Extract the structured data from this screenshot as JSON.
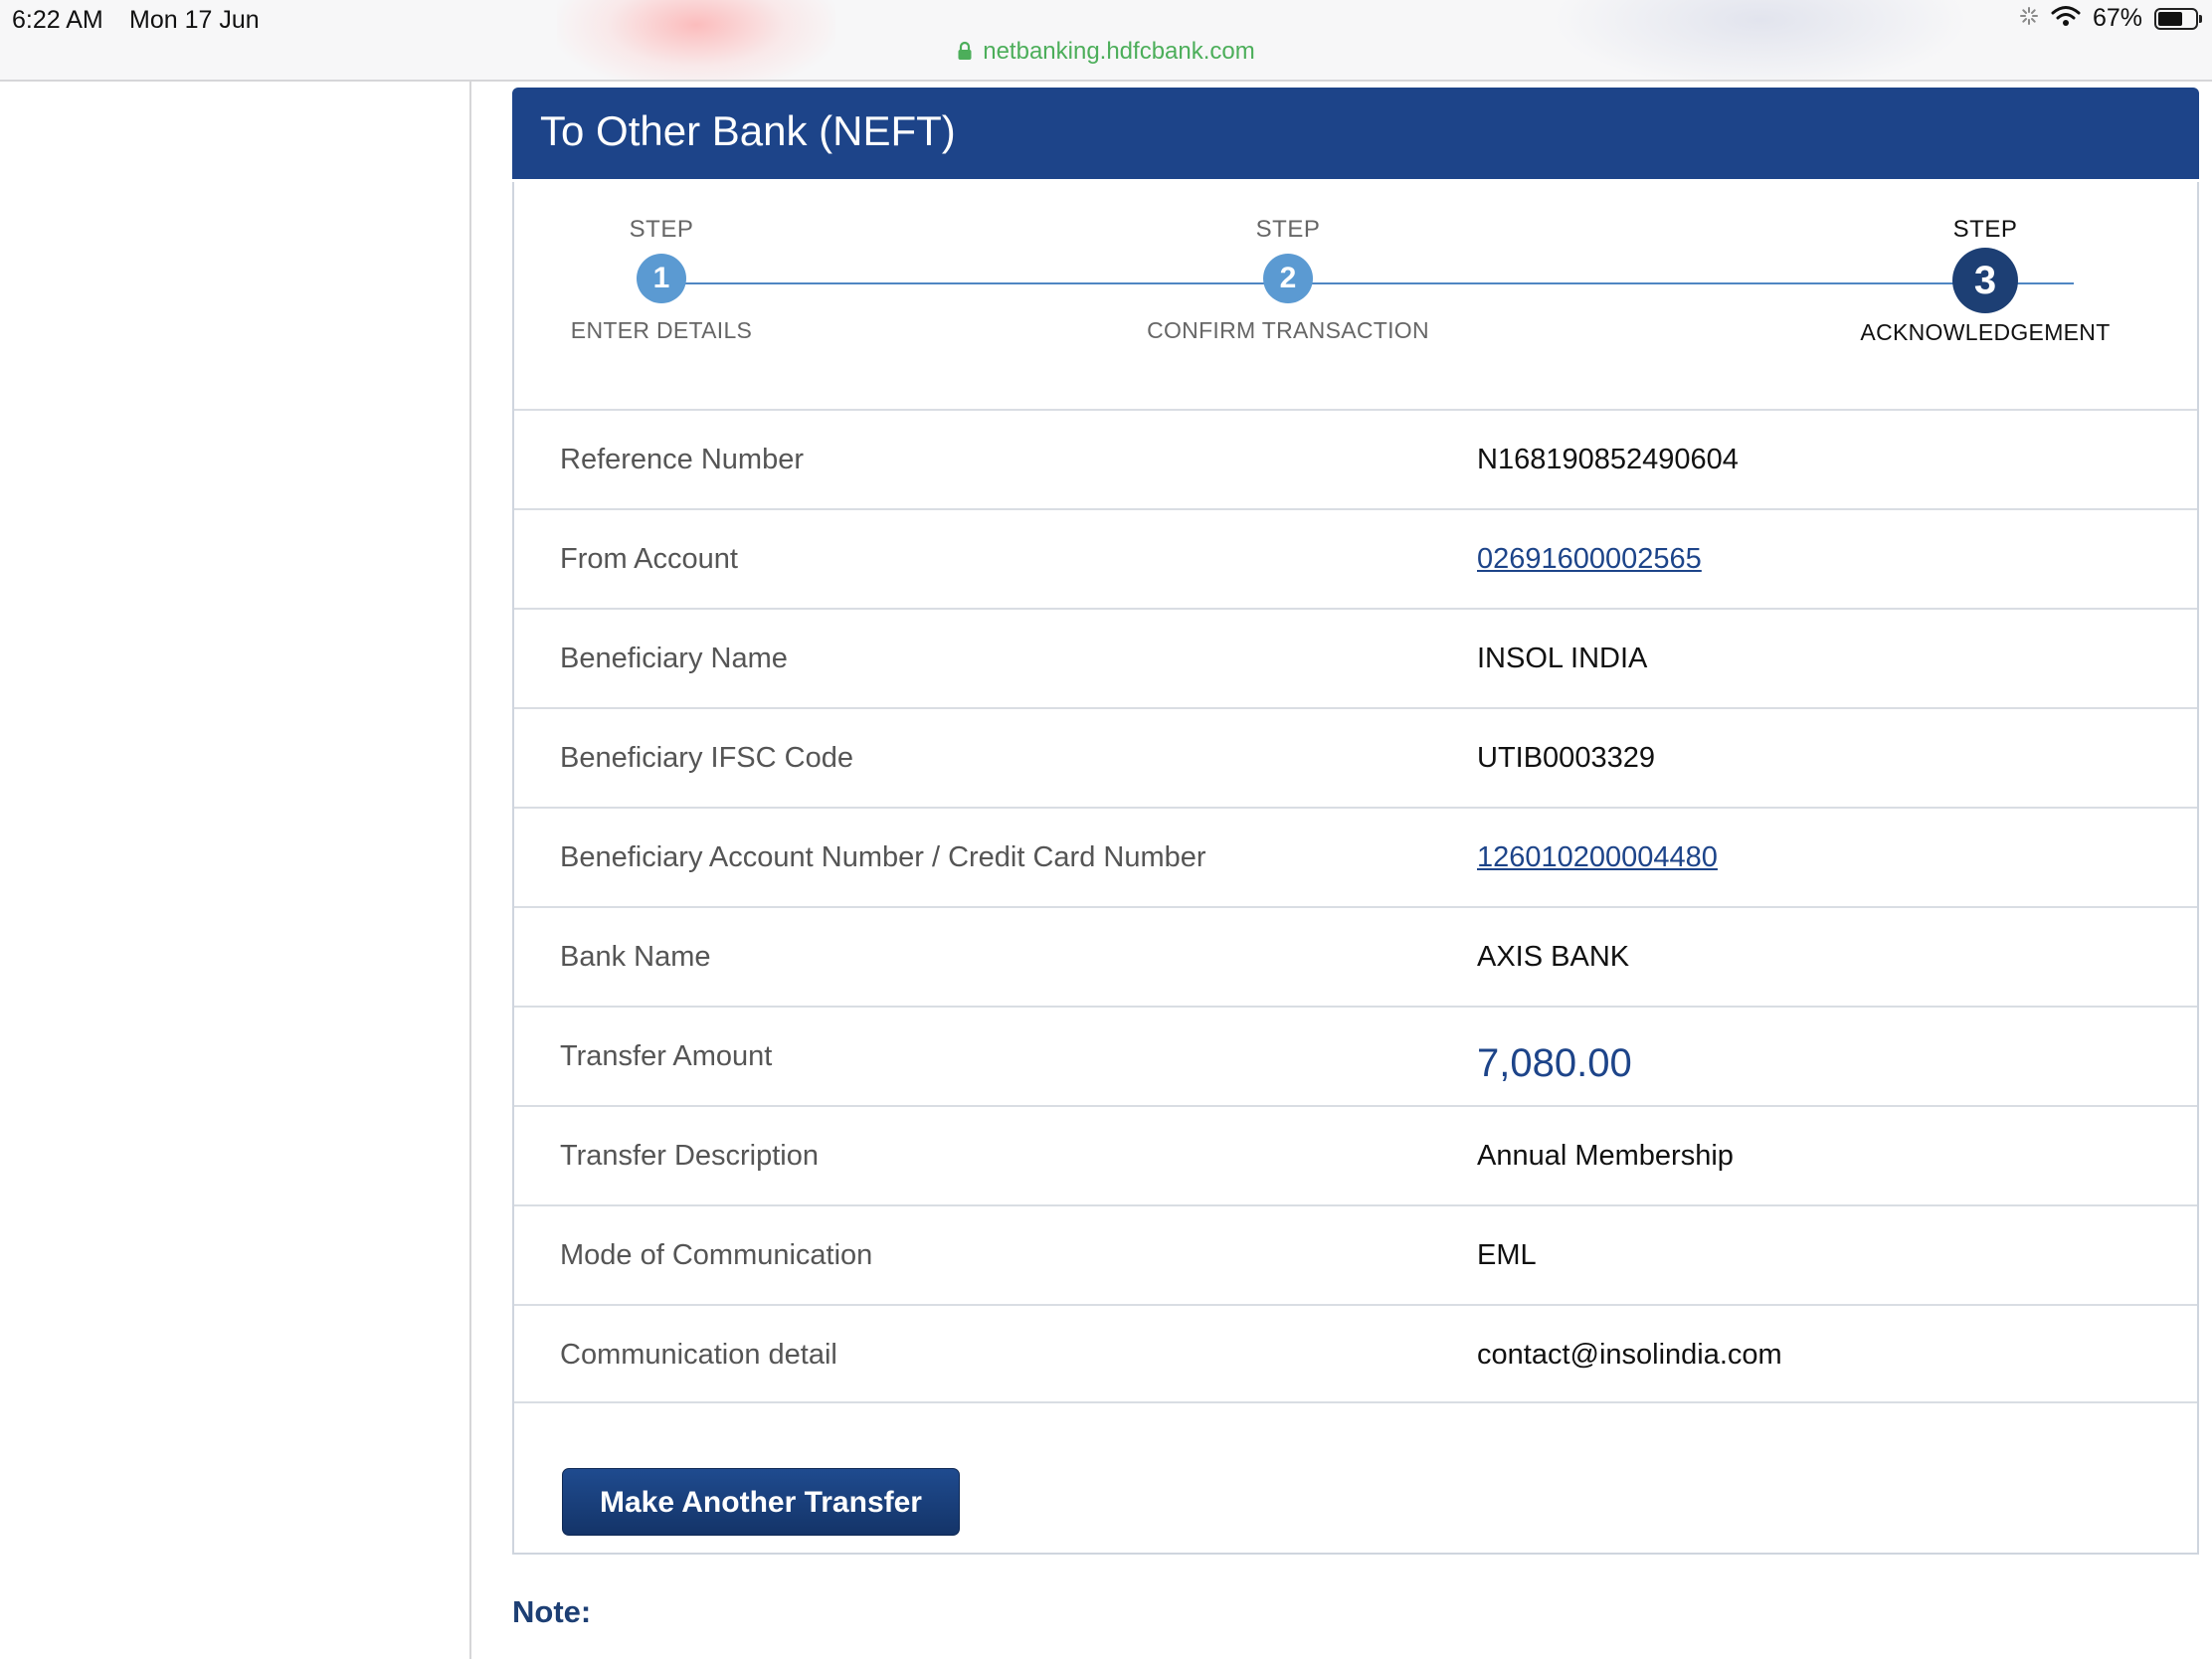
{
  "status_bar": {
    "time": "6:22 AM",
    "date": "Mon 17 Jun",
    "url": "netbanking.hdfcbank.com",
    "battery": "67%",
    "battery_level": 0.67
  },
  "panel": {
    "title": "To Other Bank (NEFT)"
  },
  "steps": [
    {
      "label": "STEP",
      "number": "1",
      "name": "ENTER DETAILS"
    },
    {
      "label": "STEP",
      "number": "2",
      "name": "CONFIRM TRANSACTION"
    },
    {
      "label": "STEP",
      "number": "3",
      "name": "ACKNOWLEDGEMENT"
    }
  ],
  "details": [
    {
      "label": "Reference Number",
      "value": "N168190852490604"
    },
    {
      "label": "From Account",
      "value": "02691600002565"
    },
    {
      "label": "Beneficiary Name",
      "value": "INSOL INDIA"
    },
    {
      "label": "Beneficiary IFSC Code",
      "value": "UTIB0003329"
    },
    {
      "label": "Beneficiary Account Number / Credit Card Number",
      "value": "126010200004480"
    },
    {
      "label": "Bank Name",
      "value": "AXIS BANK"
    },
    {
      "label": "Transfer Amount",
      "value": "7,080.00"
    },
    {
      "label": "Transfer Description",
      "value": "Annual Membership"
    },
    {
      "label": "Mode of Communication",
      "value": "EML"
    },
    {
      "label": "Communication detail",
      "value": "contact@insolindia.com"
    }
  ],
  "actions": {
    "make_another_transfer": "Make Another Transfer"
  },
  "note_label": "Note:",
  "colors": {
    "header_blue": "#1d4489",
    "step_inactive": "#5b9ad2",
    "step_active": "#1d3f74",
    "link_blue": "#1d4489",
    "url_green": "#4cae5a"
  }
}
